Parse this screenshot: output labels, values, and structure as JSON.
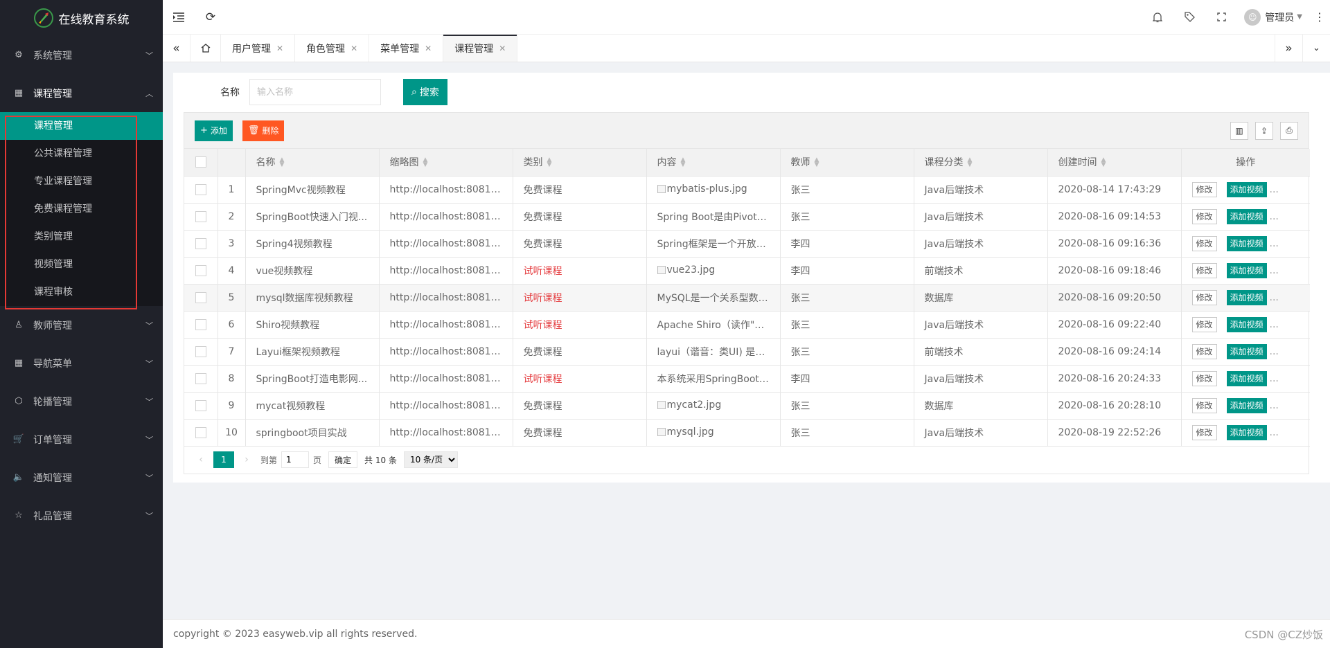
{
  "app": {
    "title": "在线教育系统"
  },
  "sidebar": {
    "menus": [
      {
        "label": "系统管理",
        "icon": "gear-icon",
        "expanded": false
      },
      {
        "label": "课程管理",
        "icon": "grid-icon",
        "expanded": true,
        "children": [
          "课程管理",
          "公共课程管理",
          "专业课程管理",
          "免费课程管理",
          "类别管理",
          "视频管理",
          "课程审核"
        ]
      },
      {
        "label": "教师管理",
        "icon": "user-icon",
        "expanded": false
      },
      {
        "label": "导航菜单",
        "icon": "grid-icon",
        "expanded": false
      },
      {
        "label": "轮播管理",
        "icon": "cube-icon",
        "expanded": false
      },
      {
        "label": "订单管理",
        "icon": "cart-icon",
        "expanded": false
      },
      {
        "label": "通知管理",
        "icon": "speaker-icon",
        "expanded": false
      },
      {
        "label": "礼品管理",
        "icon": "star-icon",
        "expanded": false
      }
    ],
    "active_sub": "课程管理",
    "highlight_color": "#e53935"
  },
  "header": {
    "user_name": "管理员"
  },
  "tabs": {
    "items": [
      "用户管理",
      "角色管理",
      "菜单管理",
      "课程管理"
    ],
    "active": "课程管理"
  },
  "search": {
    "label": "名称",
    "placeholder": "输入名称",
    "button_label": "搜索"
  },
  "toolbar": {
    "add_label": "添加",
    "delete_label": "删除"
  },
  "table": {
    "columns": [
      "名称",
      "缩略图",
      "类别",
      "内容",
      "教师",
      "课程分类",
      "创建时间",
      "操作"
    ],
    "edit_label": "修改",
    "add_video_label": "添加视频",
    "more_label": "...",
    "rows": [
      {
        "num": "1",
        "name": "SpringMvc视频教程",
        "thumb": "http://localhost:8081/ge...",
        "type": "免费课程",
        "type_red": false,
        "content": "mybatis-plus.jpg",
        "content_img": true,
        "teacher": "张三",
        "category": "Java后端技术",
        "created": "2020-08-14 17:43:29"
      },
      {
        "num": "2",
        "name": "SpringBoot快速入门视...",
        "thumb": "http://localhost:8081/ge...",
        "type": "免费课程",
        "type_red": false,
        "content": "Spring Boot是由Pivotal团队提",
        "content_img": false,
        "teacher": "张三",
        "category": "Java后端技术",
        "created": "2020-08-16 09:14:53"
      },
      {
        "num": "3",
        "name": "Spring4视频教程",
        "thumb": "http://localhost:8081/ge...",
        "type": "免费课程",
        "type_red": false,
        "content": "Spring框架是一个开放源代码",
        "content_img": false,
        "teacher": "李四",
        "category": "Java后端技术",
        "created": "2020-08-16 09:16:36"
      },
      {
        "num": "4",
        "name": "vue视频教程",
        "thumb": "http://localhost:8081/ge...",
        "type": "试听课程",
        "type_red": true,
        "content": "vue23.jpg",
        "content_img": true,
        "teacher": "李四",
        "category": "前端技术",
        "created": "2020-08-16 09:18:46"
      },
      {
        "num": "5",
        "name": "mysql数据库视频教程",
        "thumb": "http://localhost:8081/ge...",
        "type": "试听课程",
        "type_red": true,
        "content": "MySQL是一个关系型数据库管",
        "content_img": false,
        "teacher": "张三",
        "category": "数据库",
        "created": "2020-08-16 09:20:50"
      },
      {
        "num": "6",
        "name": "Shiro视频教程",
        "thumb": "http://localhost:8081/ge...",
        "type": "试听课程",
        "type_red": true,
        "content": "Apache Shiro（读作\"sheero",
        "content_img": false,
        "teacher": "张三",
        "category": "Java后端技术",
        "created": "2020-08-16 09:22:40"
      },
      {
        "num": "7",
        "name": "Layui框架视频教程",
        "thumb": "http://localhost:8081/ge...",
        "type": "免费课程",
        "type_red": false,
        "content": "layui（谐音：类UI) 是一款采",
        "content_img": false,
        "teacher": "张三",
        "category": "前端技术",
        "created": "2020-08-16 09:24:14"
      },
      {
        "num": "8",
        "name": "SpringBoot打造电影网...",
        "thumb": "http://localhost:8081/ge...",
        "type": "试听课程",
        "type_red": true,
        "content": "本系统采用SpringBoot架构，",
        "content_img": false,
        "teacher": "李四",
        "category": "Java后端技术",
        "created": "2020-08-16 20:24:33"
      },
      {
        "num": "9",
        "name": "mycat视频教程",
        "thumb": "http://localhost:8081/ge...",
        "type": "免费课程",
        "type_red": false,
        "content": "mycat2.jpg",
        "content_img": true,
        "teacher": "张三",
        "category": "数据库",
        "created": "2020-08-16 20:28:10"
      },
      {
        "num": "10",
        "name": "springboot项目实战",
        "thumb": "http://localhost:8081/ge...",
        "type": "免费课程",
        "type_red": false,
        "content": "mysql.jpg",
        "content_img": true,
        "teacher": "张三",
        "category": "Java后端技术",
        "created": "2020-08-19 22:52:26"
      }
    ]
  },
  "pager": {
    "current": "1",
    "goto_label": "到第",
    "goto_value": "1",
    "page_label": "页",
    "confirm_label": "确定",
    "total_label": "共 10 条",
    "page_size": "10 条/页"
  },
  "footer": {
    "copyright": "copyright © 2023 easyweb.vip all rights reserved."
  },
  "watermark": "CSDN @CZ炒饭",
  "colors": {
    "accent": "#009688",
    "danger": "#ff5722",
    "sidebar_bg": "#20222a",
    "red_text": "#e4393c"
  }
}
